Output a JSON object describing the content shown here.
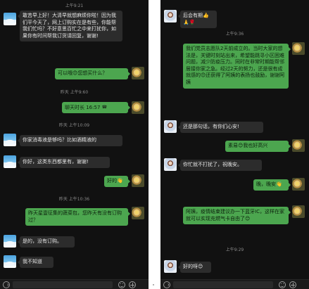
{
  "left": {
    "timestamps": [
      "上午9:21",
      "昨天 上午9:60",
      "昨天 上午10:09",
      "昨天 上午10:36"
    ],
    "messages": [
      {
        "side": "in",
        "text": "敢苦早上好！大清早就想麻烦你啦！因为我们平今天了，网上订购实在是有些，你能帮我们忙吗？不好意思百忙之中来打扰你，如果你有时间帮我订货请回复，谢谢!"
      },
      {
        "side": "out",
        "text": "可以哦",
        "emoji": "😊",
        "text2": "您想买什么？"
      },
      {
        "side": "out",
        "text": "聊天时长 16:57",
        "call_icon": "phone-icon"
      },
      {
        "side": "in",
        "text": "你家消毒液是够吗？比如酒精液的"
      },
      {
        "side": "in",
        "text": "你好，这类东西都里有，谢谢!"
      },
      {
        "side": "out",
        "text": "好的",
        "emoji": "👋"
      },
      {
        "side": "in",
        "text": "昨天星壹征集的蔬菜包，您昨天有没有订购过？"
      },
      {
        "side": "in",
        "text": "是的，没有订购。"
      },
      {
        "side": "in",
        "text": "我不知道"
      }
    ]
  },
  "right": {
    "timestamps": [
      "上午9:36",
      "上午9:29"
    ],
    "messages": [
      {
        "side": "in",
        "text": "后会有期👍🙏🌹"
      },
      {
        "side": "out",
        "text": "我们党员志愿队2天前成立的。当时大家的想法是，关键时刻站出来，希望能跳寻小区困难问题，减少防疫压力。同时在非常时期能帮邻居接你家之急。经过2天的努力，还是很有成就感的😊还获得了阿姨的表扬也鼓励，谢谢阿姨"
      },
      {
        "side": "in",
        "text": "还是那句话，有你们心安!"
      },
      {
        "side": "out",
        "text": "素易",
        "emoji": "😊",
        "text2": "我也好高兴"
      },
      {
        "side": "in",
        "text": "你忙就不打扰了，祝晚安。"
      },
      {
        "side": "out",
        "text": "晚，晚安",
        "emoji": "👋"
      },
      {
        "side": "out",
        "text": "阿姨，疫情结束建议办一下蓝牙IC，这样在家就可以实现充燃气卡自由了",
        "emoji": "😊"
      },
      {
        "side": "in",
        "text": "好的呀",
        "emoji": "😊"
      }
    ]
  },
  "colors": {
    "bg": "#111111",
    "bubble_in": "#2c2c2c",
    "bubble_out": "#4ca64f",
    "timestamp": "#8a8a8a"
  },
  "inputbar": {
    "voice_icon": "voice-icon",
    "emoji_icon": "emoji-icon",
    "plus_icon": "plus-icon"
  }
}
